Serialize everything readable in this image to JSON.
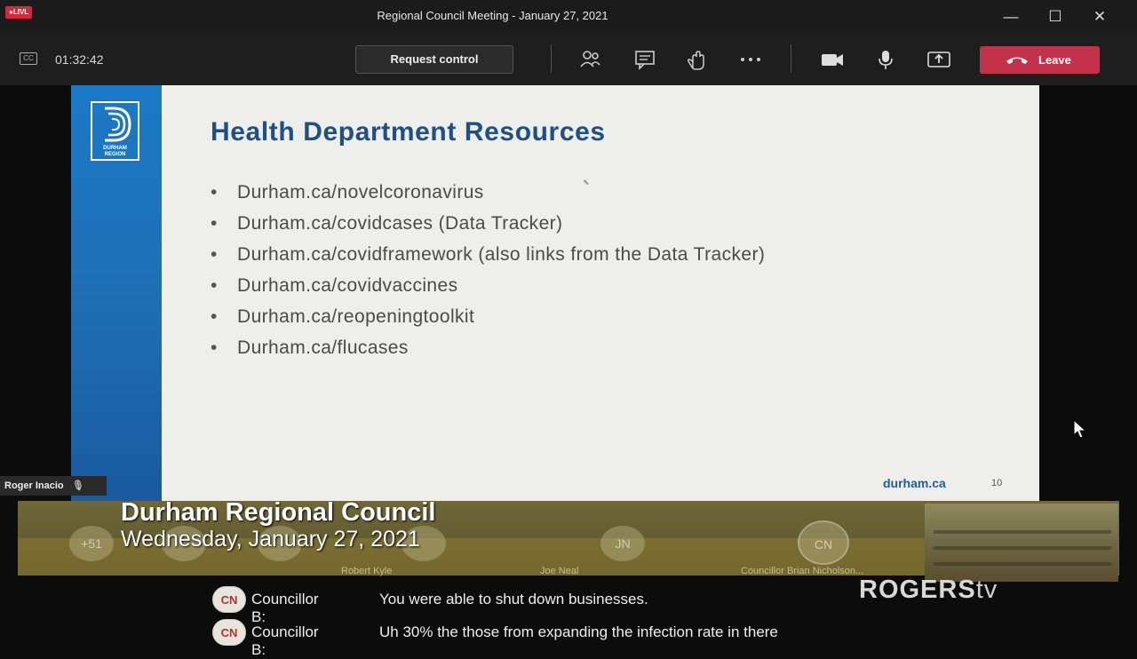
{
  "window": {
    "live_badge": "●LIVL",
    "title": "Regional Council Meeting - January 27, 2021"
  },
  "toolbar": {
    "timer": "01:32:42",
    "request_control": "Request control",
    "leave": "Leave",
    "cc_icon": "CC"
  },
  "slide": {
    "logo_text": "DURHAM REGION",
    "title": "Health Department Resources",
    "bullets": [
      "Durham.ca/novelcoronavirus",
      "Durham.ca/covidcases (Data Tracker)",
      "Durham.ca/covidframework (also links from the Data Tracker)",
      "Durham.ca/covidvaccines",
      "Durham.ca/reopeningtoolkit",
      "Durham.ca/flucases"
    ],
    "footer_url": "durham.ca",
    "page_number": "10"
  },
  "presenter": {
    "name": "Roger Inacio"
  },
  "lower_third": {
    "title": "Durham Regional Council",
    "date": "Wednesday, January 27, 2021",
    "participants": [
      {
        "initials": "+51",
        "name": ""
      },
      {
        "initials": "JN",
        "name": "Joe Neal"
      },
      {
        "initials": "CN",
        "name": "Councillor Brian Nicholson..."
      }
    ],
    "participant_name_rk": "Robert Kyle"
  },
  "captions": [
    {
      "avatar": "CN",
      "speaker": "Councillor B:",
      "text": "You were able to shut down businesses."
    },
    {
      "avatar": "CN",
      "speaker": "Councillor B:",
      "text": "Uh 30% the those from expanding the infection rate in there"
    }
  ],
  "branding": {
    "name": "ROGERS",
    "suffix": "tv"
  },
  "colors": {
    "leave": "#c4314b",
    "slide_title": "#1e4f86",
    "slide_band": "#1a79c6"
  }
}
